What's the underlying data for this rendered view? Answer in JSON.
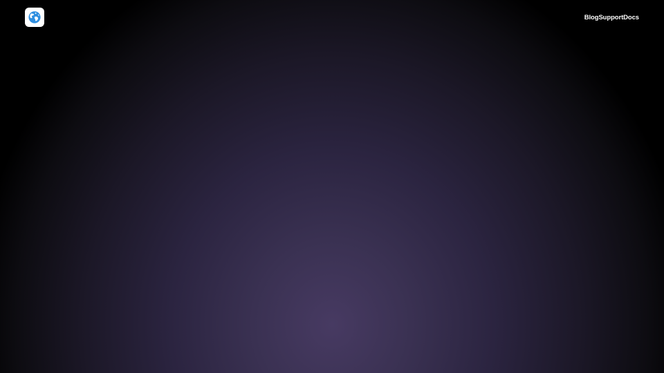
{
  "header": {
    "logo_icon": "globe-icon",
    "nav": [
      {
        "label": "Blog"
      },
      {
        "label": "Support"
      },
      {
        "label": "Docs"
      }
    ]
  },
  "colors": {
    "background_center": "#473a62",
    "background_edge": "#000000",
    "nav_text": "#ffffff",
    "logo_tile": "#ffffff",
    "globe_blue": "#2f8fe0"
  }
}
